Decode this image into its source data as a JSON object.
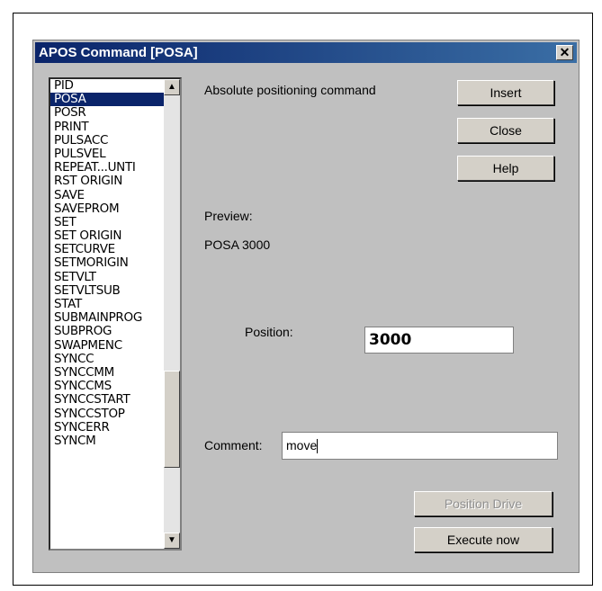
{
  "window": {
    "title": "APOS Command [POSA]",
    "close_glyph": "✕"
  },
  "commands": {
    "items": [
      "PID",
      "POSA",
      "POSR",
      "PRINT",
      "PULSACC",
      "PULSVEL",
      "REPEAT...UNTI",
      "RST ORIGIN",
      "SAVE",
      "SAVEPROM",
      "SET",
      "SET ORIGIN",
      "SETCURVE",
      "SETMORIGIN",
      "SETVLT",
      "SETVLTSUB",
      "STAT",
      "SUBMAINPROG",
      "SUBPROG",
      "SWAPMENC",
      "SYNCC",
      "SYNCCMM",
      "SYNCCMS",
      "SYNCCSTART",
      "SYNCCSTOP",
      "SYNCERR",
      "SYNCM"
    ],
    "selected": "POSA"
  },
  "description": "Absolute positioning command",
  "buttons": {
    "insert": "Insert",
    "close": "Close",
    "help": "Help",
    "position_drive": "Position Drive",
    "execute_now": "Execute now"
  },
  "preview": {
    "label": "Preview:",
    "value": "POSA 3000"
  },
  "position": {
    "label": "Position:",
    "value": "3000"
  },
  "comment": {
    "label": "Comment:",
    "value": "move"
  },
  "scroll_icons": {
    "up": "▲",
    "down": "▼"
  }
}
